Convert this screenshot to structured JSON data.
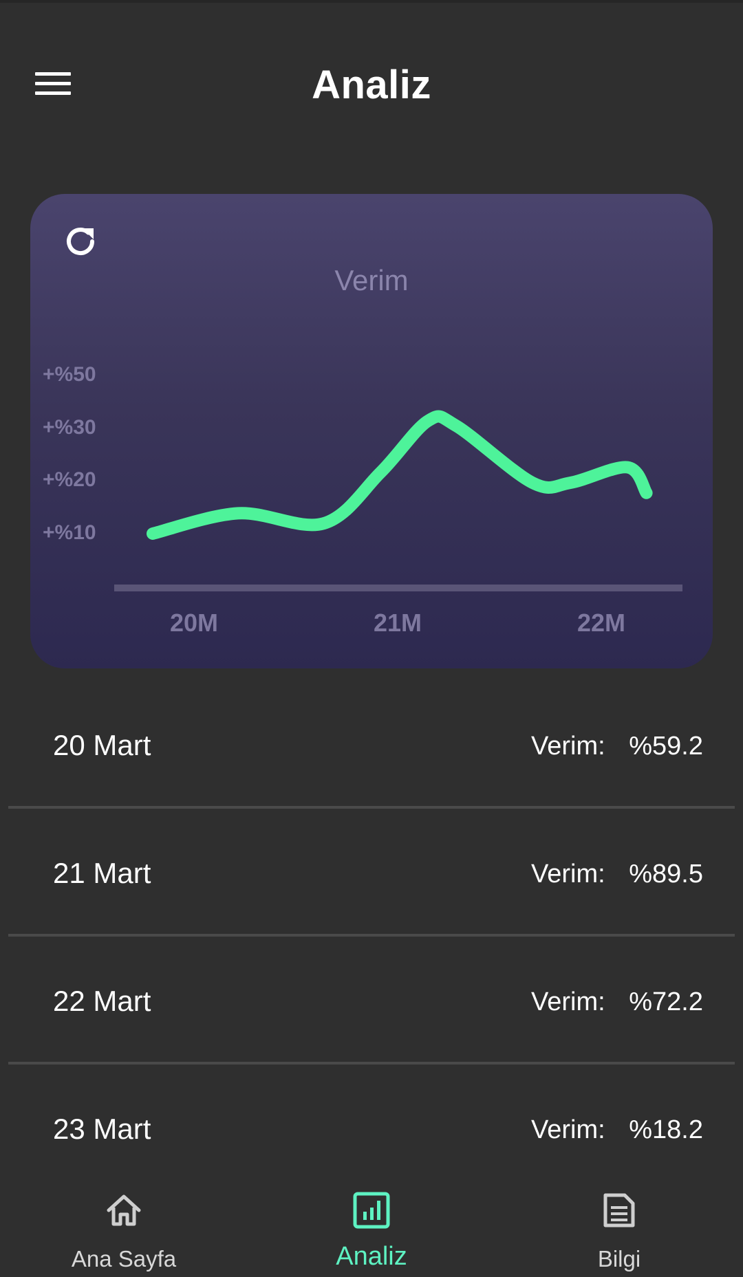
{
  "header": {
    "title": "Analiz",
    "menu_icon": "menu-icon"
  },
  "chart_card": {
    "refresh_icon": "refresh-icon",
    "line_color": "#4ef39a",
    "chart_data": {
      "type": "line",
      "title": "Verim",
      "y_tick_labels": [
        "+%50",
        "+%30",
        "+%20",
        "+%10"
      ],
      "x_tick_labels": [
        "20M",
        "21M",
        "22M"
      ],
      "series": [
        {
          "x": [
            0.0,
            0.45,
            0.9,
            1.2,
            1.45,
            1.6,
            2.0,
            2.2,
            2.5,
            2.6
          ],
          "y": [
            10,
            14,
            12,
            22,
            34,
            32,
            20,
            20,
            23,
            18
          ]
        }
      ],
      "grid": false
    }
  },
  "entries": [
    {
      "date": "20 Mart",
      "label": "Verim:",
      "value": "%59.2"
    },
    {
      "date": "21 Mart",
      "label": "Verim:",
      "value": "%89.5"
    },
    {
      "date": "22 Mart",
      "label": "Verim:",
      "value": "%72.2"
    },
    {
      "date": "23 Mart",
      "label": "Verim:",
      "value": "%18.2"
    }
  ],
  "bottom_nav": {
    "active_color": "#5ef2c2",
    "items": [
      {
        "label": "Ana Sayfa",
        "icon": "home-icon"
      },
      {
        "label": "Analiz",
        "icon": "bar-chart-icon",
        "active": true
      },
      {
        "label": "Bilgi",
        "icon": "document-icon"
      }
    ]
  }
}
